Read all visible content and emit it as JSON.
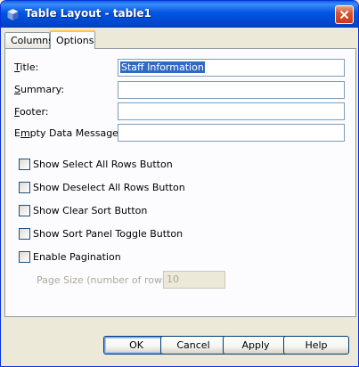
{
  "window": {
    "title": "Table Layout - table1"
  },
  "tabs": [
    {
      "label": "Columns",
      "active": false
    },
    {
      "label": "Options",
      "active": true
    }
  ],
  "form": {
    "title_label": "Title:",
    "title_value": "Staff Information",
    "summary_label": "Summary:",
    "summary_value": "",
    "footer_label": "Footer:",
    "footer_value": "",
    "empty_label": "Empty Data Message:",
    "empty_value": ""
  },
  "checkboxes": [
    {
      "label": "Show Select All Rows Button",
      "checked": false
    },
    {
      "label": "Show Deselect All Rows Button",
      "checked": false
    },
    {
      "label": "Show Clear Sort Button",
      "checked": false
    },
    {
      "label": "Show Sort Panel Toggle Button",
      "checked": false
    },
    {
      "label": "Enable Pagination",
      "checked": false
    }
  ],
  "pagination": {
    "page_size_label": "Page Size (number of rows):",
    "page_size_value": "10",
    "enabled": false
  },
  "buttons": {
    "ok": "OK",
    "cancel": "Cancel",
    "apply": "Apply",
    "help": "Help"
  },
  "colors": {
    "titlebar": "#0054e3",
    "dialog_bg": "#ece9d8",
    "selection": "#316ac5",
    "tab_highlight": "#ffc83c"
  }
}
